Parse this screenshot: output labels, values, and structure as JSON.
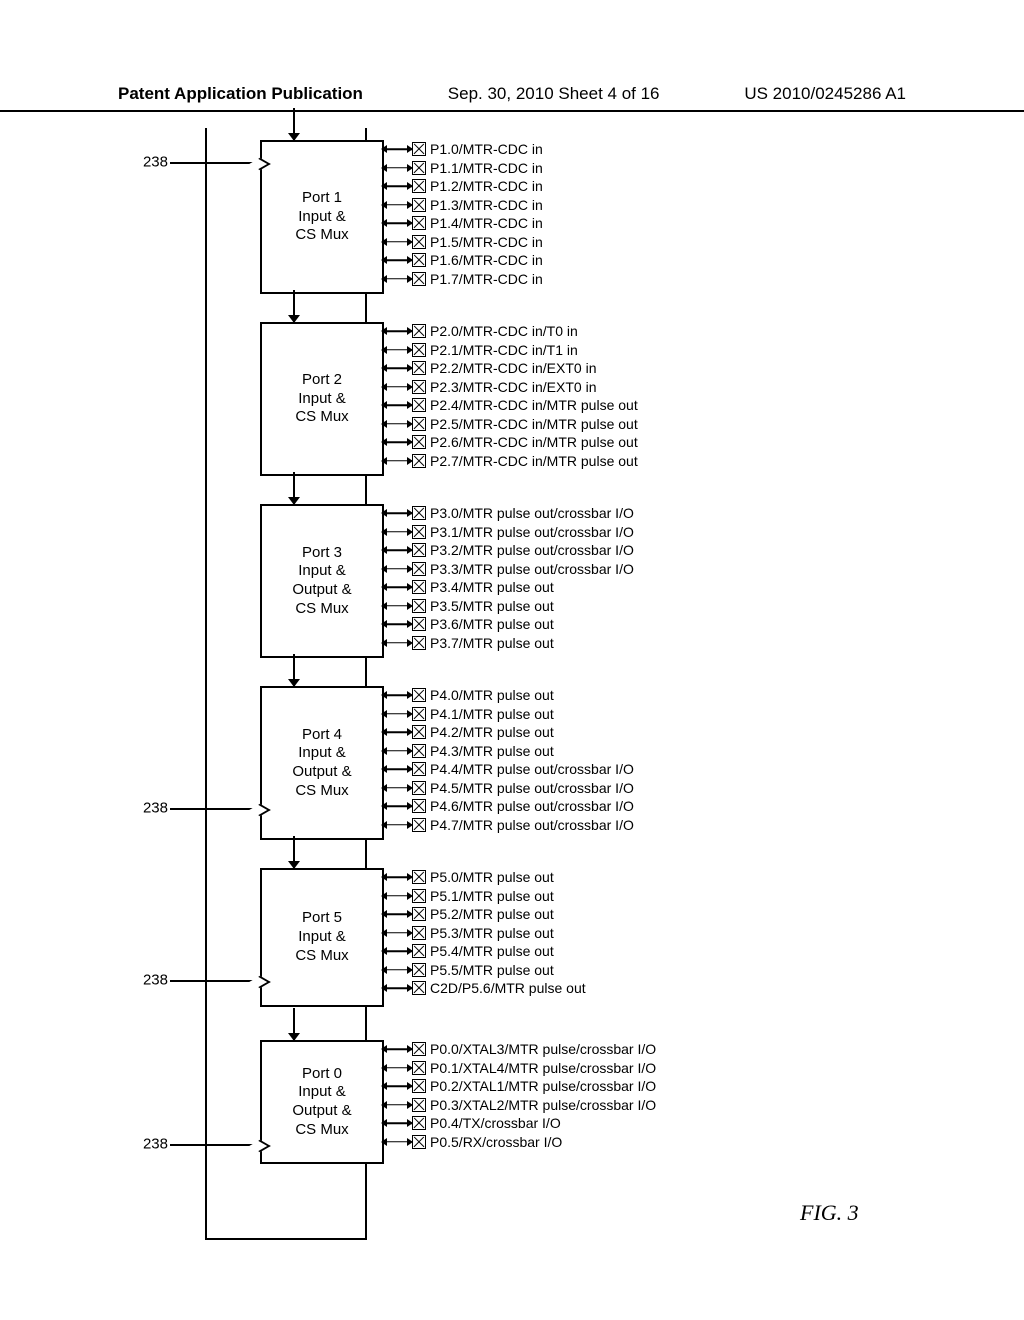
{
  "header": {
    "left": "Patent Application Publication",
    "mid": "Sep. 30, 2010  Sheet 4 of 16",
    "right": "US 2010/0245286 A1"
  },
  "figure_caption": "FIG. 3",
  "ports": [
    {
      "ref": "238",
      "title_lines": [
        "Port 1",
        "Input &",
        "CS Mux"
      ],
      "pins": [
        "P1.0/MTR-CDC in",
        "P1.1/MTR-CDC in",
        "P1.2/MTR-CDC in",
        "P1.3/MTR-CDC in",
        "P1.4/MTR-CDC in",
        "P1.5/MTR-CDC in",
        "P1.6/MTR-CDC in",
        "P1.7/MTR-CDC in"
      ],
      "ref_top": true
    },
    {
      "title_lines": [
        "Port 2",
        "Input &",
        "CS Mux"
      ],
      "pins": [
        "P2.0/MTR-CDC in/T0 in",
        "P2.1/MTR-CDC in/T1 in",
        "P2.2/MTR-CDC in/EXT0 in",
        "P2.3/MTR-CDC in/EXT0 in",
        "P2.4/MTR-CDC in/MTR pulse out",
        "P2.5/MTR-CDC in/MTR pulse out",
        "P2.6/MTR-CDC in/MTR pulse out",
        "P2.7/MTR-CDC in/MTR pulse out"
      ]
    },
    {
      "title_lines": [
        "Port 3",
        "Input &",
        "Output &",
        "CS Mux"
      ],
      "pins": [
        "P3.0/MTR pulse out/crossbar I/O",
        "P3.1/MTR pulse out/crossbar I/O",
        "P3.2/MTR pulse out/crossbar I/O",
        "P3.3/MTR pulse out/crossbar I/O",
        "P3.4/MTR pulse out",
        "P3.5/MTR pulse out",
        "P3.6/MTR pulse out",
        "P3.7/MTR pulse out"
      ]
    },
    {
      "ref": "238",
      "title_lines": [
        "Port 4",
        "Input &",
        "Output &",
        "CS Mux"
      ],
      "pins": [
        "P4.0/MTR pulse out",
        "P4.1/MTR pulse out",
        "P4.2/MTR pulse out",
        "P4.3/MTR pulse out",
        "P4.4/MTR pulse out/crossbar I/O",
        "P4.5/MTR pulse out/crossbar I/O",
        "P4.6/MTR pulse out/crossbar I/O",
        "P4.7/MTR pulse out/crossbar I/O"
      ]
    },
    {
      "ref": "238",
      "title_lines": [
        "Port 5",
        "Input &",
        "CS Mux"
      ],
      "short": true,
      "pins": [
        "P5.0/MTR pulse out",
        "P5.1/MTR pulse out",
        "P5.2/MTR pulse out",
        "P5.3/MTR pulse out",
        "P5.4/MTR pulse out",
        "P5.5/MTR pulse out",
        "C2D/P5.6/MTR pulse out"
      ]
    },
    {
      "ref": "238",
      "title_lines": [
        "Port 0",
        "Input &",
        "Output &",
        "CS Mux"
      ],
      "port0": true,
      "pins": [
        "P0.0/XTAL3/MTR pulse/crossbar I/O",
        "P0.1/XTAL4/MTR pulse/crossbar I/O",
        "P0.2/XTAL1/MTR pulse/crossbar I/O",
        "P0.3/XTAL2/MTR pulse/crossbar I/O",
        "P0.4/TX/crossbar I/O",
        "P0.5/RX/crossbar I/O"
      ]
    }
  ]
}
